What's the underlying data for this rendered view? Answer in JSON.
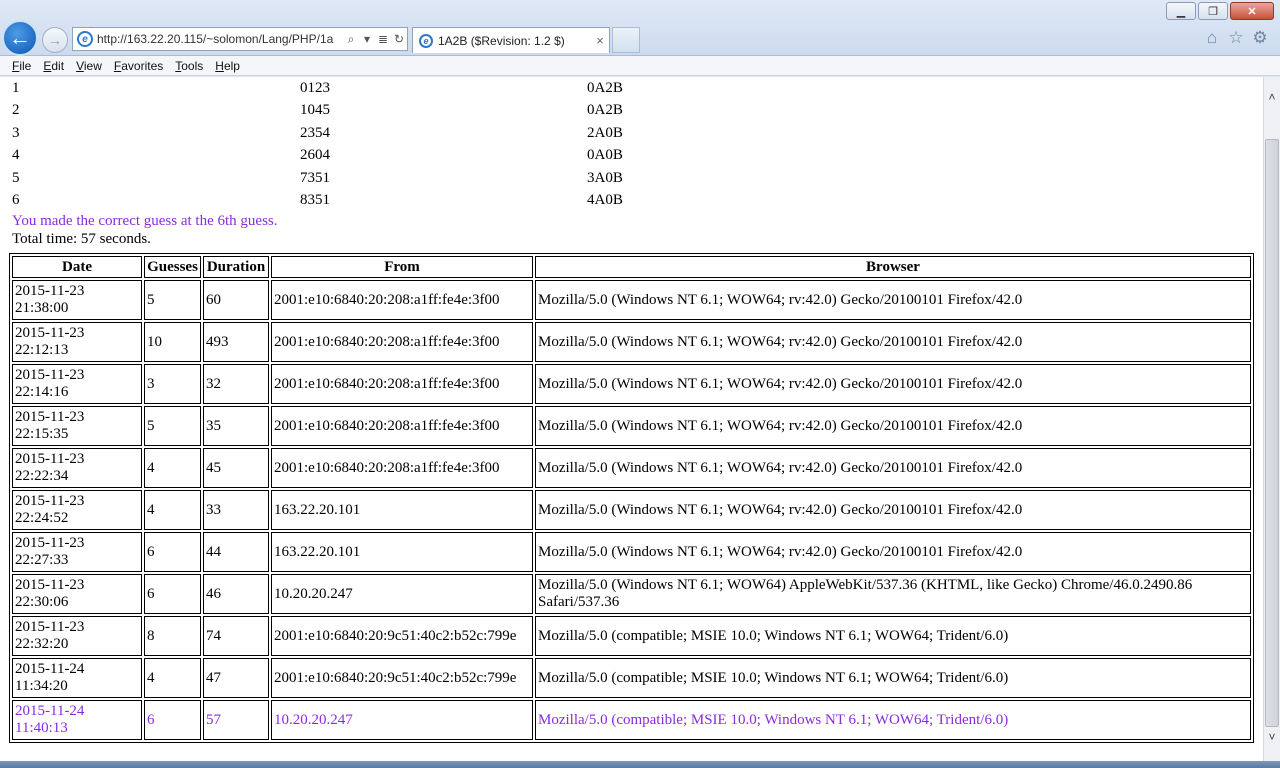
{
  "browser": {
    "address": "http://163.22.20.115/~solomon/Lang/PHP/1a",
    "tab_title": "1A2B ($Revision: 1.2 $)",
    "tab_close": "×",
    "window_min": "▁",
    "window_restore": "❐",
    "window_close": "✕",
    "back": "←",
    "forward": "→",
    "search_glyph": "⌕",
    "dropdown_glyph": "▾",
    "compat_glyph": "≣",
    "refresh_glyph": "↻",
    "home_glyph": "⌂",
    "fav_glyph": "☆",
    "tools_glyph": "⚙"
  },
  "menu": [
    "File",
    "Edit",
    "View",
    "Favorites",
    "Tools",
    "Help"
  ],
  "guesses": [
    {
      "n": "1",
      "guess": "0123",
      "result": "0A2B"
    },
    {
      "n": "2",
      "guess": "1045",
      "result": "0A2B"
    },
    {
      "n": "3",
      "guess": "2354",
      "result": "2A0B"
    },
    {
      "n": "4",
      "guess": "2604",
      "result": "0A0B"
    },
    {
      "n": "5",
      "guess": "7351",
      "result": "3A0B"
    },
    {
      "n": "6",
      "guess": "8351",
      "result": "4A0B"
    }
  ],
  "message": "You made the correct guess at the 6th guess.",
  "total_time": "Total time: 57 seconds.",
  "table": {
    "headers": [
      "Date",
      "Guesses",
      "Duration",
      "From",
      "Browser"
    ],
    "rows": [
      {
        "date1": "2015-11-23",
        "date2": "21:38:00",
        "guesses": "5",
        "duration": "60",
        "from": "2001:e10:6840:20:208:a1ff:fe4e:3f00",
        "browser": "Mozilla/5.0 (Windows NT 6.1; WOW64; rv:42.0) Gecko/20100101 Firefox/42.0"
      },
      {
        "date1": "2015-11-23",
        "date2": "22:12:13",
        "guesses": "10",
        "duration": "493",
        "from": "2001:e10:6840:20:208:a1ff:fe4e:3f00",
        "browser": "Mozilla/5.0 (Windows NT 6.1; WOW64; rv:42.0) Gecko/20100101 Firefox/42.0"
      },
      {
        "date1": "2015-11-23",
        "date2": "22:14:16",
        "guesses": "3",
        "duration": "32",
        "from": "2001:e10:6840:20:208:a1ff:fe4e:3f00",
        "browser": "Mozilla/5.0 (Windows NT 6.1; WOW64; rv:42.0) Gecko/20100101 Firefox/42.0"
      },
      {
        "date1": "2015-11-23",
        "date2": "22:15:35",
        "guesses": "5",
        "duration": "35",
        "from": "2001:e10:6840:20:208:a1ff:fe4e:3f00",
        "browser": "Mozilla/5.0 (Windows NT 6.1; WOW64; rv:42.0) Gecko/20100101 Firefox/42.0"
      },
      {
        "date1": "2015-11-23",
        "date2": "22:22:34",
        "guesses": "4",
        "duration": "45",
        "from": "2001:e10:6840:20:208:a1ff:fe4e:3f00",
        "browser": "Mozilla/5.0 (Windows NT 6.1; WOW64; rv:42.0) Gecko/20100101 Firefox/42.0"
      },
      {
        "date1": "2015-11-23",
        "date2": "22:24:52",
        "guesses": "4",
        "duration": "33",
        "from": "163.22.20.101",
        "browser": "Mozilla/5.0 (Windows NT 6.1; WOW64; rv:42.0) Gecko/20100101 Firefox/42.0"
      },
      {
        "date1": "2015-11-23",
        "date2": "22:27:33",
        "guesses": "6",
        "duration": "44",
        "from": "163.22.20.101",
        "browser": "Mozilla/5.0 (Windows NT 6.1; WOW64; rv:42.0) Gecko/20100101 Firefox/42.0"
      },
      {
        "date1": "2015-11-23",
        "date2": "22:30:06",
        "guesses": "6",
        "duration": "46",
        "from": "10.20.20.247",
        "browser": "Mozilla/5.0 (Windows NT 6.1; WOW64) AppleWebKit/537.36 (KHTML, like Gecko) Chrome/46.0.2490.86 Safari/537.36"
      },
      {
        "date1": "2015-11-23",
        "date2": "22:32:20",
        "guesses": "8",
        "duration": "74",
        "from": "2001:e10:6840:20:9c51:40c2:b52c:799e",
        "browser": "Mozilla/5.0 (compatible; MSIE 10.0; Windows NT 6.1; WOW64; Trident/6.0)"
      },
      {
        "date1": "2015-11-24",
        "date2": "11:34:20",
        "guesses": "4",
        "duration": "47",
        "from": "2001:e10:6840:20:9c51:40c2:b52c:799e",
        "browser": "Mozilla/5.0 (compatible; MSIE 10.0; Windows NT 6.1; WOW64; Trident/6.0)"
      },
      {
        "date1": "2015-11-24",
        "date2": "11:40:13",
        "guesses": "6",
        "duration": "57",
        "from": "10.20.20.247",
        "browser": "Mozilla/5.0 (compatible; MSIE 10.0; Windows NT 6.1; WOW64; Trident/6.0)",
        "highlight": true
      }
    ]
  },
  "colors": {
    "highlight": "#8a2be2",
    "accent": "#0a57b3"
  },
  "scroll": {
    "up": "˄",
    "down": "˅"
  }
}
